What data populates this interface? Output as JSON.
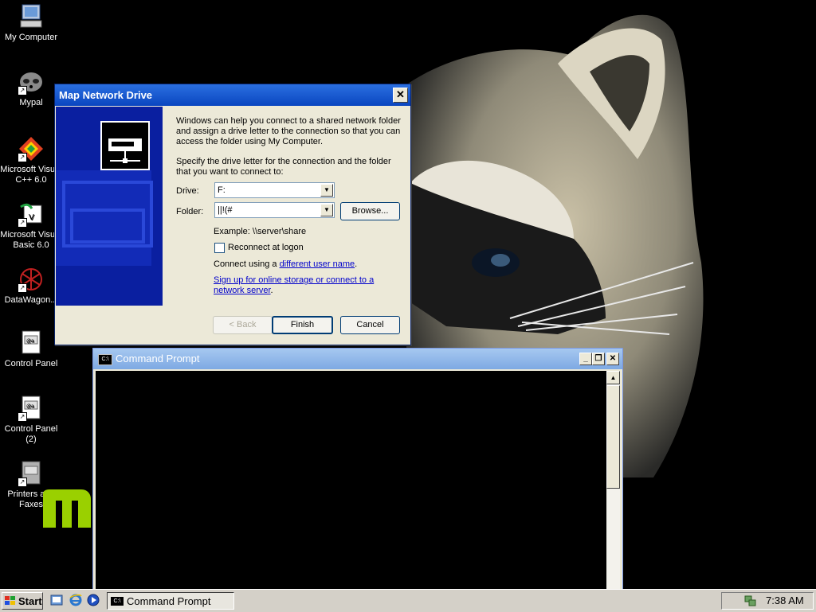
{
  "desktop": {
    "icons": [
      {
        "label": "My Computer",
        "icon": "my-computer-icon"
      },
      {
        "label": "Mypal",
        "icon": "mypal-icon"
      },
      {
        "label": "Microsoft Visual C++ 6.0",
        "icon": "visual-cpp-icon"
      },
      {
        "label": "Microsoft Visual Basic 6.0",
        "icon": "visual-basic-icon"
      },
      {
        "label": "DataWagon...",
        "icon": "datawagon-icon"
      },
      {
        "label": "Control Panel",
        "icon": "control-panel-icon"
      },
      {
        "label": "Control Panel (2)",
        "icon": "control-panel-icon"
      },
      {
        "label": "Printers and Faxes",
        "icon": "printers-icon"
      }
    ]
  },
  "dialog": {
    "title": "Map Network Drive",
    "intro": "Windows can help you connect to a shared network folder and assign a drive letter to the connection so that you can access the folder using My Computer.",
    "instruction": "Specify the drive letter for the connection and the folder that you want to connect to:",
    "drive_label": "Drive:",
    "drive_value": "F:",
    "folder_label": "Folder:",
    "folder_value": "||!(#",
    "browse_label": "Browse...",
    "example": "Example: \\\\server\\share",
    "reconnect_label": "Reconnect at logon",
    "connect_prefix": "Connect using a ",
    "connect_link": "different user name",
    "connect_suffix": ".",
    "signup_link": "Sign up for online storage or connect to a network server",
    "signup_suffix": ".",
    "back_label": "< Back",
    "finish_label": "Finish",
    "cancel_label": "Cancel"
  },
  "cmd": {
    "title": "Command Prompt",
    "icon_text": "C:\\"
  },
  "taskbar": {
    "start_label": "Start",
    "task_label": "Command Prompt",
    "clock": "7:38 AM"
  }
}
